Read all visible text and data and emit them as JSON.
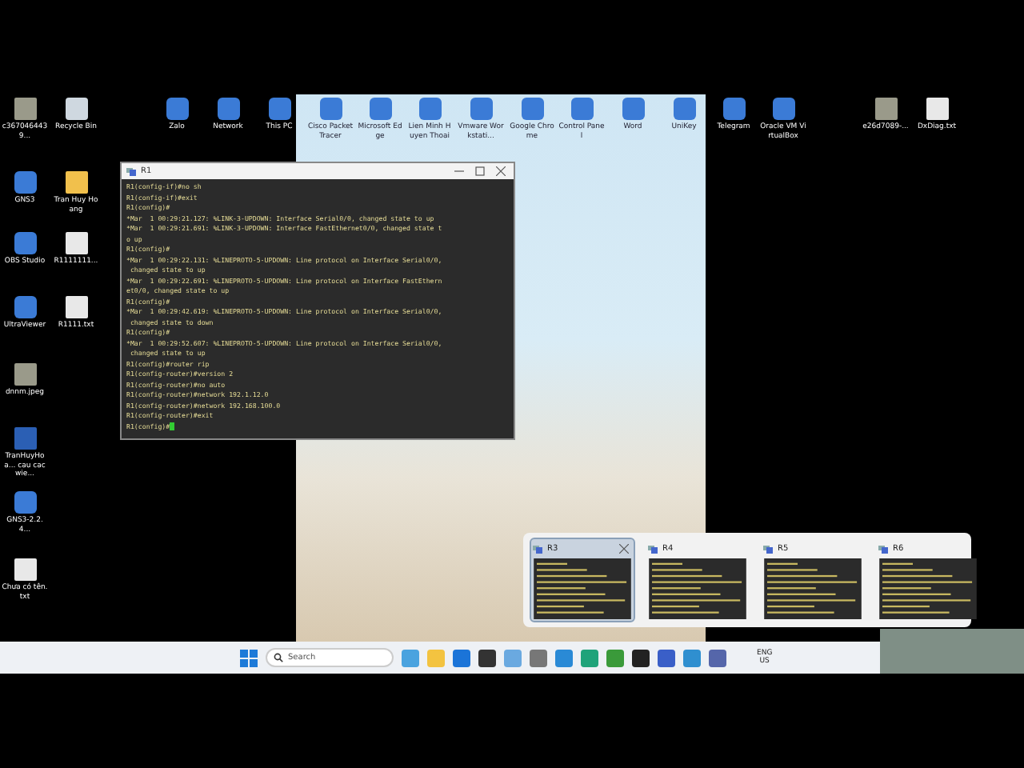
{
  "desktop_icons": [
    {
      "label": "c3670464439...",
      "kind": "image"
    },
    {
      "label": "Recycle Bin",
      "kind": "bin"
    },
    {
      "label": "Zalo",
      "kind": "app"
    },
    {
      "label": "Network",
      "kind": "app"
    },
    {
      "label": "This PC",
      "kind": "app"
    },
    {
      "label": "Cisco Packet Tracer",
      "kind": "app"
    },
    {
      "label": "Microsoft Edge",
      "kind": "app"
    },
    {
      "label": "Lien Minh Huyen Thoai",
      "kind": "app"
    },
    {
      "label": "Vmware Workstati...",
      "kind": "app"
    },
    {
      "label": "Google Chrome",
      "kind": "app"
    },
    {
      "label": "Control Panel",
      "kind": "app"
    },
    {
      "label": "Word",
      "kind": "app"
    },
    {
      "label": "UniKey",
      "kind": "app"
    },
    {
      "label": "Telegram",
      "kind": "app"
    },
    {
      "label": "Oracle VM VirtualBox",
      "kind": "app"
    },
    {
      "label": "e26d7089-...",
      "kind": "image"
    },
    {
      "label": "DxDiag.txt",
      "kind": "file"
    },
    {
      "label": "GNS3",
      "kind": "app"
    },
    {
      "label": "Tran Huy Hoang",
      "kind": "folder"
    },
    {
      "label": "OBS Studio",
      "kind": "app"
    },
    {
      "label": "R1111111...",
      "kind": "file"
    },
    {
      "label": "UltraViewer",
      "kind": "app"
    },
    {
      "label": "R1111.txt",
      "kind": "file"
    },
    {
      "label": "dnnm.jpeg",
      "kind": "image"
    },
    {
      "label": "TranHuyHoa... cau cac wie...",
      "kind": "doc"
    },
    {
      "label": "GNS3-2.2.4...",
      "kind": "app"
    },
    {
      "label": "Chưa có tên.txt",
      "kind": "file"
    }
  ],
  "terminal": {
    "title": "R1",
    "lines": [
      "R1(config-if)#no sh",
      "R1(config-if)#exit",
      "R1(config)#",
      "*Mar  1 00:29:21.127: %LINK-3-UPDOWN: Interface Serial0/0, changed state to up",
      "*Mar  1 00:29:21.691: %LINK-3-UPDOWN: Interface FastEthernet0/0, changed state t",
      "o up",
      "R1(config)#",
      "*Mar  1 00:29:22.131: %LINEPROTO-5-UPDOWN: Line protocol on Interface Serial0/0,",
      " changed state to up",
      "*Mar  1 00:29:22.691: %LINEPROTO-5-UPDOWN: Line protocol on Interface FastEthern",
      "et0/0, changed state to up",
      "R1(config)#",
      "*Mar  1 00:29:42.619: %LINEPROTO-5-UPDOWN: Line protocol on Interface Serial0/0,",
      " changed state to down",
      "R1(config)#",
      "*Mar  1 00:29:52.607: %LINEPROTO-5-UPDOWN: Line protocol on Interface Serial0/0,",
      " changed state to up",
      "R1(config)#router rip",
      "R1(config-router)#version 2",
      "R1(config-router)#no auto",
      "R1(config-router)#network 192.1.12.0",
      "R1(config-router)#network 192.168.100.0",
      "R1(config-router)#exit",
      "R1(config)#"
    ]
  },
  "task_previews": [
    {
      "title": "R3",
      "hovered": true
    },
    {
      "title": "R4",
      "hovered": false
    },
    {
      "title": "R5",
      "hovered": false
    },
    {
      "title": "R6",
      "hovered": false
    }
  ],
  "taskbar": {
    "search_placeholder": "Search",
    "apps": [
      {
        "kind": "gallery"
      },
      {
        "kind": "files"
      },
      {
        "kind": "shield"
      },
      {
        "kind": "dropbox"
      },
      {
        "kind": "monitor"
      },
      {
        "kind": "settings"
      },
      {
        "kind": "vmware"
      },
      {
        "kind": "edge"
      },
      {
        "kind": "chrome"
      },
      {
        "kind": "obs"
      },
      {
        "kind": "putty-blue"
      },
      {
        "kind": "notes"
      },
      {
        "kind": "network"
      }
    ],
    "language": "ENG",
    "region": "US"
  }
}
